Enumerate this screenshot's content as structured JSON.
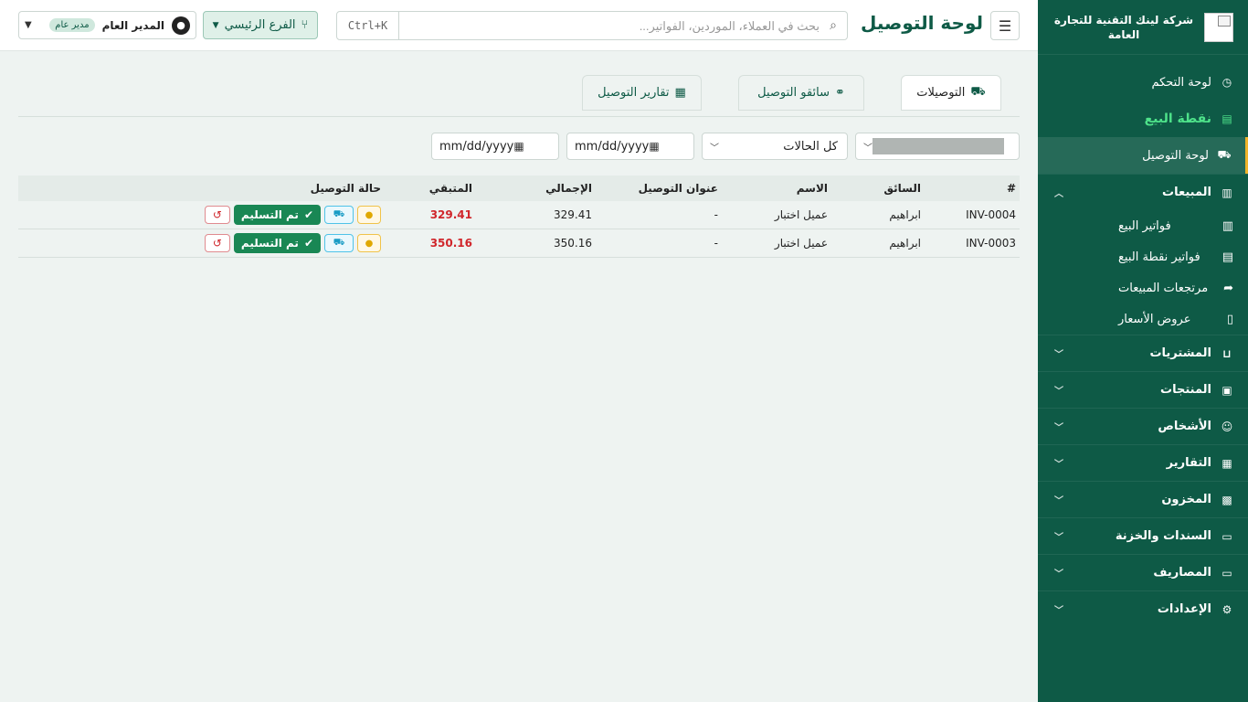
{
  "colors": {
    "sidebar_bg": "#0e5a46",
    "accent": "#0e5a46",
    "pos_green": "#4ee28a",
    "active_border": "#f0b429",
    "remaining_red": "#d0262b",
    "delivered_green": "#198754"
  },
  "brand": {
    "name": "شركة لينك التقنية للتجارة العامة"
  },
  "sidebar": {
    "items": [
      {
        "label": "لوحة التحكم",
        "icon": "gauge-icon"
      },
      {
        "label": "نقطة البيع",
        "icon": "cash-register-icon"
      },
      {
        "label": "لوحة التوصيل",
        "icon": "truck-fast-icon"
      },
      {
        "label": "المبيعات",
        "icon": "receipt-icon"
      },
      {
        "label": "فواتير البيع",
        "icon": "receipt-icon"
      },
      {
        "label": "فواتير نقطة البيع",
        "icon": "cash-register-icon"
      },
      {
        "label": "مرتجعات المبيعات",
        "icon": "share-icon"
      },
      {
        "label": "عروض الأسعار",
        "icon": "file-icon"
      },
      {
        "label": "المشتريات",
        "icon": "cart-icon"
      },
      {
        "label": "المنتجات",
        "icon": "box-icon"
      },
      {
        "label": "الأشخاص",
        "icon": "users-icon"
      },
      {
        "label": "التقارير",
        "icon": "chart-icon"
      },
      {
        "label": "المخزون",
        "icon": "boxes-icon"
      },
      {
        "label": "السندات والخزنة",
        "icon": "money-check-icon"
      },
      {
        "label": "المصاريف",
        "icon": "money-bill-icon"
      },
      {
        "label": "الإعدادات",
        "icon": "gear-icon"
      }
    ]
  },
  "header": {
    "title": "لوحة التوصيل",
    "search_placeholder": "بحث في العملاء، الموردين، الفواتير...",
    "shortcut": "Ctrl+K",
    "branch": "الفرع الرئيسي",
    "user_name": "المدير العام",
    "user_role": "مدير عام"
  },
  "tabs": [
    {
      "label": "التوصيلات",
      "icon": "truck-fast-icon"
    },
    {
      "label": "سائقو التوصيل",
      "icon": "motorcycle-icon"
    },
    {
      "label": "تقارير التوصيل",
      "icon": "chart-icon"
    }
  ],
  "filters": {
    "status": "كل الحالات",
    "date_from_placeholder": "mm/dd/yyyy",
    "date_to_placeholder": "mm/dd/yyyy"
  },
  "table": {
    "headers": {
      "no": "#",
      "driver": "السائق",
      "name": "الاسم",
      "address": "عنوان التوصيل",
      "total": "الإجمالي",
      "remaining": "المتبقي",
      "status": "حالة التوصيل"
    },
    "rows": [
      {
        "no": "INV-0004",
        "driver": "ابراهيم",
        "name": "عميل اختبار",
        "address": "-",
        "total": "329.41",
        "remaining": "329.41",
        "status": "تم التسليم"
      },
      {
        "no": "INV-0003",
        "driver": "ابراهيم",
        "name": "عميل اختبار",
        "address": "-",
        "total": "350.16",
        "remaining": "350.16",
        "status": "تم التسليم"
      }
    ]
  }
}
